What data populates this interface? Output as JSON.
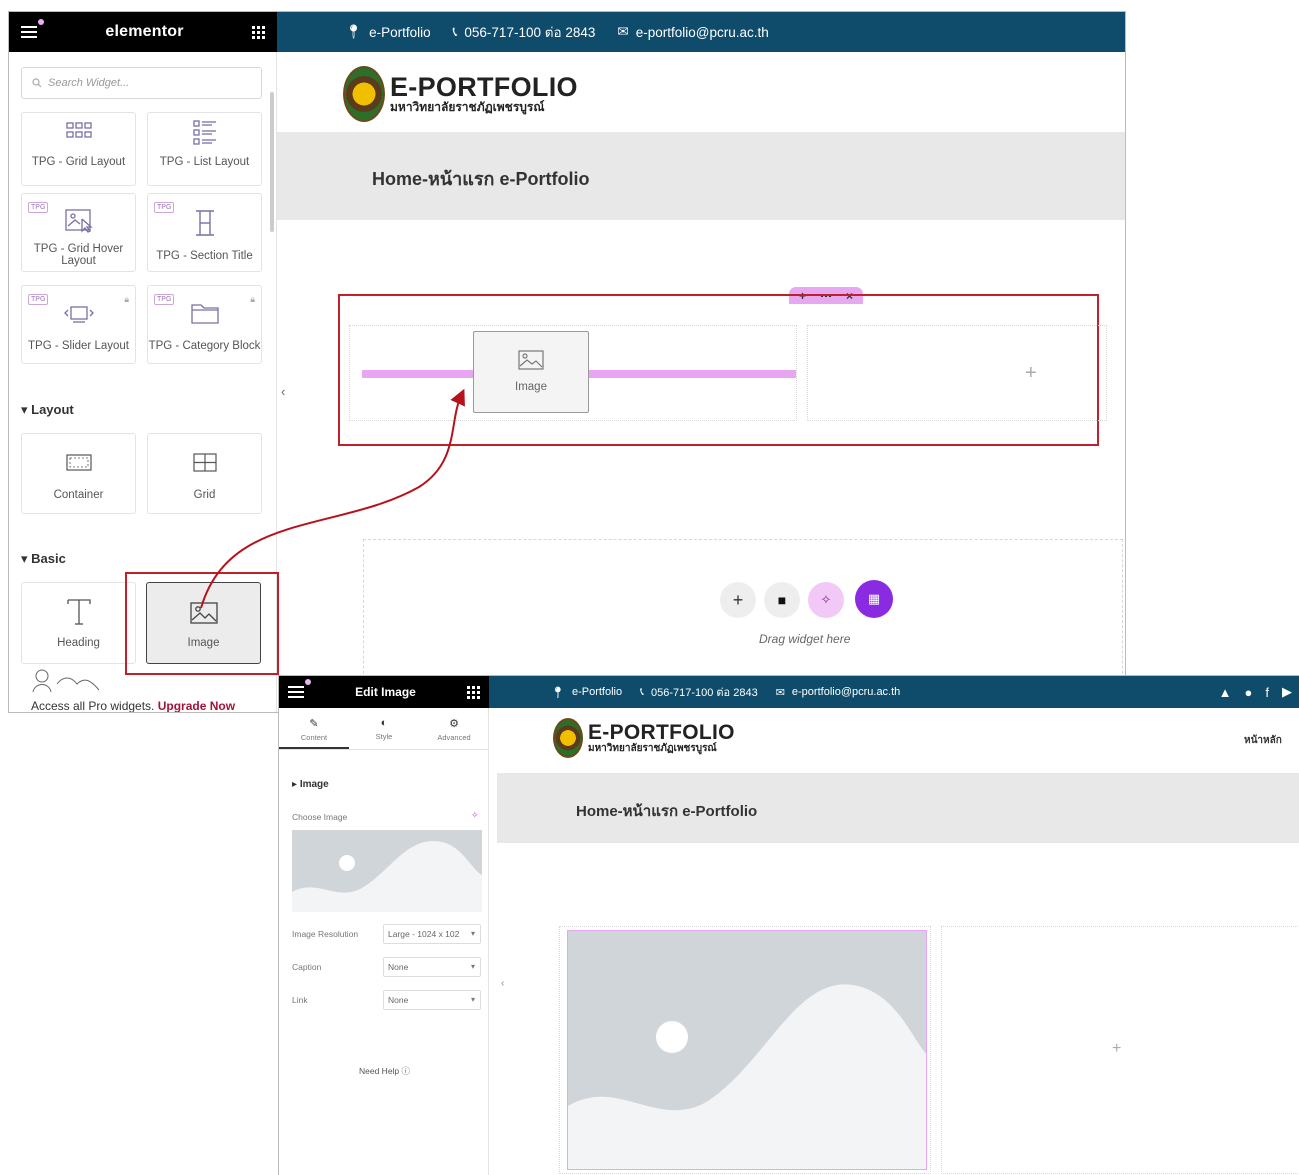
{
  "editor1": {
    "brand": "elementor",
    "search_placeholder": "Search Widget...",
    "widgets_tpg": [
      {
        "label": "TPG - Grid Layout",
        "icon": "grid-layout-icon"
      },
      {
        "label": "TPG - List Layout",
        "icon": "list-layout-icon"
      },
      {
        "label": "TPG - Grid Hover Layout",
        "icon": "grid-hover-icon"
      },
      {
        "label": "TPG - Section Title",
        "icon": "section-title-icon"
      },
      {
        "label": "TPG - Slider Layout",
        "icon": "slider-icon"
      },
      {
        "label": "TPG - Category Block",
        "icon": "folder-icon"
      }
    ],
    "tpg_badge": "TPG",
    "section_layout": "Layout",
    "layout_widgets": [
      "Container",
      "Grid"
    ],
    "section_basic": "Basic",
    "basic_widgets": [
      "Heading",
      "Image"
    ],
    "promo_text": "Access all Pro widgets.",
    "promo_link": "Upgrade Now"
  },
  "site": {
    "topbar": {
      "portfolio": "e-Portfolio",
      "phone": "056-717-100 ต่อ 2843",
      "email": "e-portfolio@pcru.ac.th"
    },
    "logo_title": "E-PORTFOLIO",
    "logo_subtitle": "มหาวิทยาลัยราชภัฏเพชรบูรณ์",
    "hero_title": "Home-หน้าแรก e-Portfolio",
    "drag_ghost_label": "Image",
    "drop_hint": "Drag widget here",
    "nav_home": "หน้าหลัก"
  },
  "editor2": {
    "title": "Edit Image",
    "tabs": [
      {
        "label": "Content",
        "icon": "pencil-icon"
      },
      {
        "label": "Style",
        "icon": "contrast-icon"
      },
      {
        "label": "Advanced",
        "icon": "gear-icon"
      }
    ],
    "section": "Image",
    "choose_image": "Choose Image",
    "resolution_label": "Image Resolution",
    "resolution_value": "Large - 1024 x 102",
    "caption_label": "Caption",
    "caption_value": "None",
    "link_label": "Link",
    "link_value": "None",
    "help": "Need Help"
  },
  "colors": {
    "accent_red": "#c0202a",
    "site_bar": "#0f4c6b",
    "pink": "#e8a6f2",
    "purple": "#8a2be2"
  }
}
